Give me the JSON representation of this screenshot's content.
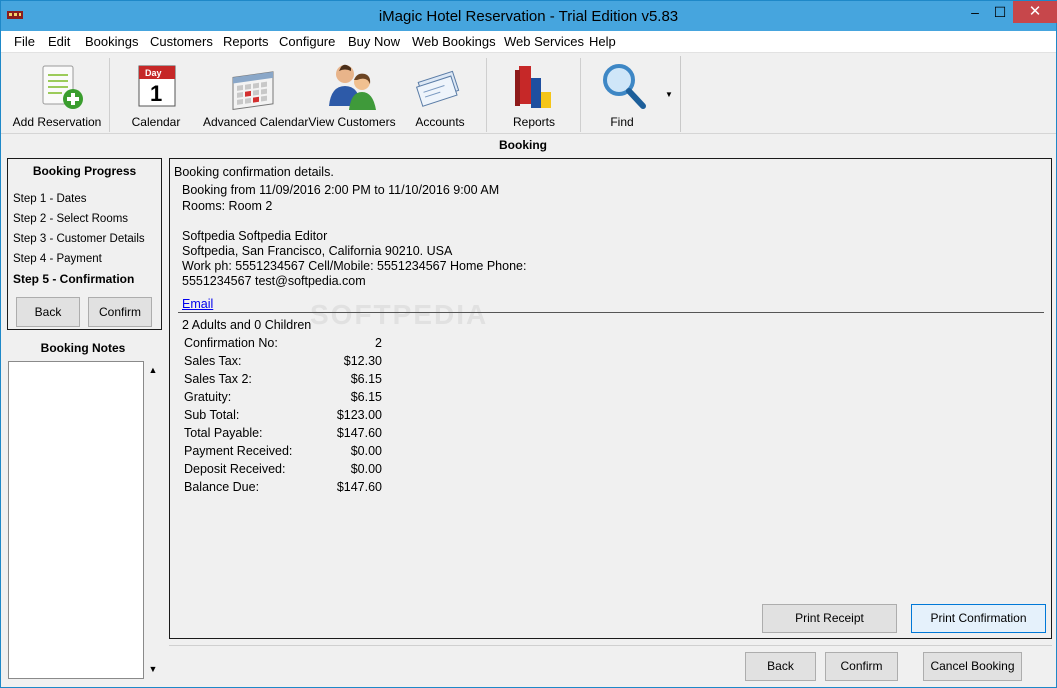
{
  "window": {
    "title": "iMagic Hotel Reservation - Trial Edition v5.83"
  },
  "window_controls": {
    "minimize": "–",
    "maximize": "☐",
    "close": "✕"
  },
  "menu": [
    "File",
    "Edit",
    "Bookings",
    "Customers",
    "Reports",
    "Configure",
    "Buy Now",
    "Web Bookings",
    "Web Services",
    "Help"
  ],
  "toolbar": {
    "add_reservation": "Add Reservation",
    "calendar": "Calendar",
    "calendar_icon_day": "Day",
    "calendar_icon_num": "1",
    "advanced_calendar": "Advanced Calendar",
    "view_customers": "View Customers",
    "accounts": "Accounts",
    "reports": "Reports",
    "find": "Find",
    "find_caret": "▼"
  },
  "section_title": "Booking",
  "booking_progress": {
    "heading": "Booking Progress",
    "steps": [
      "Step 1 - Dates",
      "Step 2 - Select Rooms",
      "Step 3 - Customer Details",
      "Step 4 - Payment",
      "Step 5 - Confirmation"
    ],
    "back_label": "Back",
    "confirm_label": "Confirm"
  },
  "booking_notes": {
    "heading": "Booking Notes",
    "scroll_up": "▲",
    "scroll_down": "▼"
  },
  "details": {
    "heading": "Booking confirmation details.",
    "booking_from": "Booking from 11/09/2016 2:00 PM to 11/10/2016 9:00 AM",
    "rooms": "Rooms: Room 2",
    "customer_name": "Softpedia Softpedia Editor",
    "address": "Softpedia, San Francisco, California 90210. USA",
    "phones": "Work ph: 5551234567 Cell/Mobile: 5551234567 Home Phone:",
    "phone_email": "5551234567 test@softpedia.com",
    "email_link": "Email",
    "guests": "2 Adults and 0 Children",
    "watermark": "SOFTPEDIA",
    "financials": [
      {
        "label": "Confirmation No:",
        "value": "2"
      },
      {
        "label": "Sales Tax:",
        "value": "$12.30"
      },
      {
        "label": "Sales Tax 2:",
        "value": "$6.15"
      },
      {
        "label": "Gratuity:",
        "value": "$6.15"
      },
      {
        "label": "Sub Total:",
        "value": "$123.00"
      },
      {
        "label": "Total Payable:",
        "value": "$147.60"
      },
      {
        "label": "Payment Received:",
        "value": "$0.00"
      },
      {
        "label": "Deposit Received:",
        "value": "$0.00"
      },
      {
        "label": "Balance Due:",
        "value": "$147.60"
      }
    ],
    "print_receipt": "Print Receipt",
    "print_confirmation": "Print Confirmation"
  },
  "footer": {
    "back": "Back",
    "confirm": "Confirm",
    "cancel_booking": "Cancel Booking"
  },
  "colors": {
    "titlebar": "#46a5de",
    "close": "#c7474b",
    "link": "#0000ee"
  }
}
